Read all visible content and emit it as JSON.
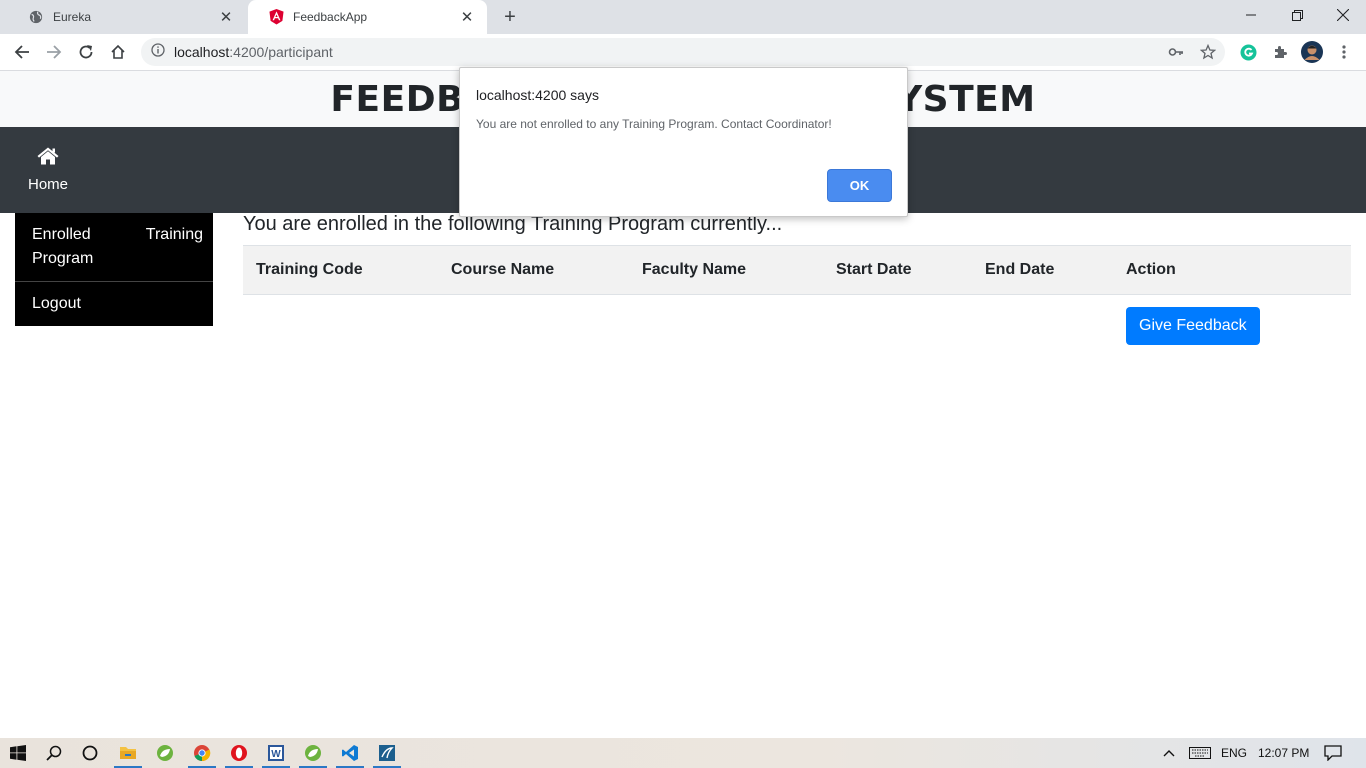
{
  "browser": {
    "tabs": [
      {
        "title": "Eureka",
        "icon": "globe-icon",
        "active": false
      },
      {
        "title": "FeedbackApp",
        "icon": "angular-icon",
        "active": true
      }
    ],
    "address": {
      "host": "localhost",
      "rest": ":4200/participant"
    }
  },
  "page": {
    "header_title": "FEEDBACK MANAGEMENT SYSTEM",
    "nav": {
      "home_label": "Home"
    },
    "sidebar": {
      "enrolled_word1": "Enrolled",
      "enrolled_word2": "Training",
      "enrolled_word3": "Program",
      "logout": "Logout"
    },
    "main_heading": "You are enrolled in the following Training Program currently...",
    "table": {
      "columns": [
        "Training Code",
        "Course Name",
        "Faculty Name",
        "Start Date",
        "End Date",
        "Action"
      ],
      "action_button": "Give Feedback"
    }
  },
  "dialog": {
    "origin": "localhost:4200 says",
    "message": "You are not enrolled to any Training Program. Contact Coordinator!",
    "ok_label": "OK"
  },
  "taskbar": {
    "language": "ENG",
    "time": "12:07 PM"
  },
  "colors": {
    "navbar": "#343a40",
    "primary_button": "#007bff",
    "dialog_ok": "#4a8cf0"
  }
}
